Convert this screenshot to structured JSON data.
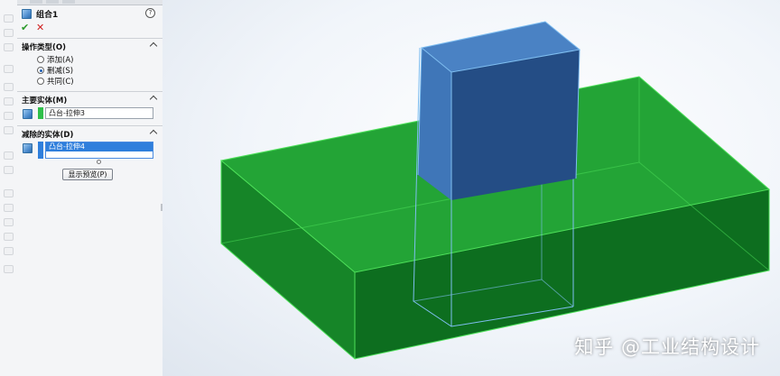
{
  "panel": {
    "title": "组合1",
    "help_label": "?",
    "ok_label": "✔",
    "cancel_label": "✕",
    "operation_type": {
      "header": "操作类型(O)",
      "options": [
        {
          "label": "添加(A)",
          "selected": false
        },
        {
          "label": "删减(S)",
          "selected": true
        },
        {
          "label": "共同(C)",
          "selected": false
        }
      ]
    },
    "main_body": {
      "header": "主要实体(M)",
      "value": "凸台-拉伸3",
      "color": "#2fbf4a"
    },
    "subtract_bodies": {
      "header": "减除的实体(D)",
      "items": [
        "凸台-拉伸4"
      ],
      "color": "#2f7fdc"
    },
    "preview_button": "显示预览(P)"
  },
  "viewport": {
    "watermark": "知乎 @工业结构设计",
    "colors": {
      "main_body": "#1c8a2c",
      "tool_body": "#2e5f9a",
      "edge_green": "#4ee05a",
      "edge_blue": "#7fbef0"
    }
  }
}
